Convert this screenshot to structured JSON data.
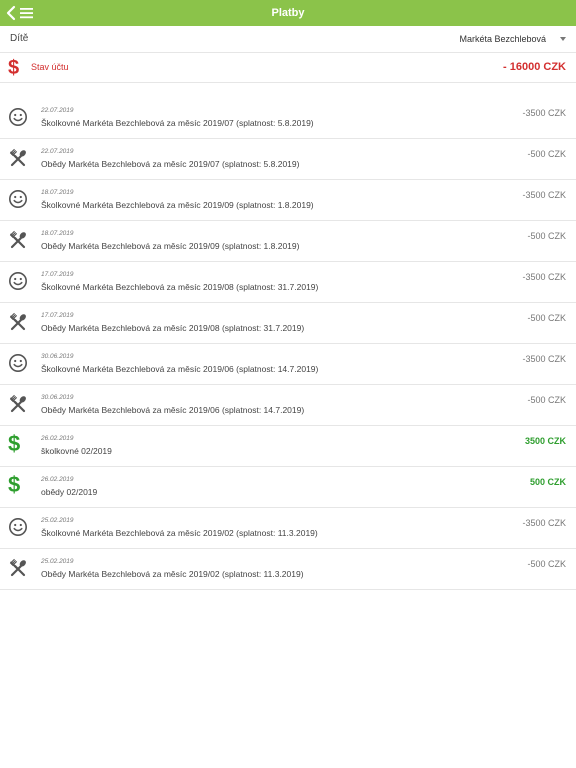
{
  "header": {
    "title": "Platby",
    "back_icon": "back-arrow-icon",
    "menu_icon": "hamburger-menu-icon",
    "bar_color": "#8bc34a"
  },
  "child": {
    "label": "Dítě",
    "selected": "Markéta Bezchlebová"
  },
  "balance": {
    "label": "Stav účtu",
    "amount": "- 16000 CZK",
    "icon": "dollar-icon",
    "color": "#d32f2f"
  },
  "payments": [
    {
      "icon": "smiley-icon",
      "date": "22.07.2019",
      "description": "Školkovné Markéta Bezchlebová za měsíc 2019/07 (splatnost: 5.8.2019)",
      "amount": "-3500 CZK",
      "positive": false
    },
    {
      "icon": "cutlery-icon",
      "date": "22.07.2019",
      "description": "Obědy Markéta Bezchlebová za měsíc 2019/07 (splatnost: 5.8.2019)",
      "amount": "-500 CZK",
      "positive": false
    },
    {
      "icon": "smiley-icon",
      "date": "18.07.2019",
      "description": "Školkovné Markéta Bezchlebová za měsíc 2019/09 (splatnost: 1.8.2019)",
      "amount": "-3500 CZK",
      "positive": false
    },
    {
      "icon": "cutlery-icon",
      "date": "18.07.2019",
      "description": "Obědy Markéta Bezchlebová za měsíc 2019/09 (splatnost: 1.8.2019)",
      "amount": "-500 CZK",
      "positive": false
    },
    {
      "icon": "smiley-icon",
      "date": "17.07.2019",
      "description": "Školkovné Markéta Bezchlebová za měsíc 2019/08 (splatnost: 31.7.2019)",
      "amount": "-3500 CZK",
      "positive": false
    },
    {
      "icon": "cutlery-icon",
      "date": "17.07.2019",
      "description": "Obědy Markéta Bezchlebová za měsíc 2019/08 (splatnost: 31.7.2019)",
      "amount": "-500 CZK",
      "positive": false
    },
    {
      "icon": "smiley-icon",
      "date": "30.06.2019",
      "description": "Školkovné Markéta Bezchlebová za měsíc 2019/06 (splatnost: 14.7.2019)",
      "amount": "-3500 CZK",
      "positive": false
    },
    {
      "icon": "cutlery-icon",
      "date": "30.06.2019",
      "description": "Obědy Markéta Bezchlebová za měsíc 2019/06 (splatnost: 14.7.2019)",
      "amount": "-500 CZK",
      "positive": false
    },
    {
      "icon": "dollar-icon",
      "date": "26.02.2019",
      "description": "školkovné 02/2019",
      "amount": "3500 CZK",
      "positive": true
    },
    {
      "icon": "dollar-icon",
      "date": "26.02.2019",
      "description": "obědy 02/2019",
      "amount": "500 CZK",
      "positive": true
    },
    {
      "icon": "smiley-icon",
      "date": "25.02.2019",
      "description": "Školkovné Markéta Bezchlebová za měsíc 2019/02 (splatnost: 11.3.2019)",
      "amount": "-3500 CZK",
      "positive": false
    },
    {
      "icon": "cutlery-icon",
      "date": "25.02.2019",
      "description": "Obědy Markéta Bezchlebová za měsíc 2019/02 (splatnost: 11.3.2019)",
      "amount": "-500 CZK",
      "positive": false
    }
  ],
  "colors": {
    "positive": "#2e9e2e",
    "negative_text": "#777777",
    "accent": "#8bc34a"
  }
}
